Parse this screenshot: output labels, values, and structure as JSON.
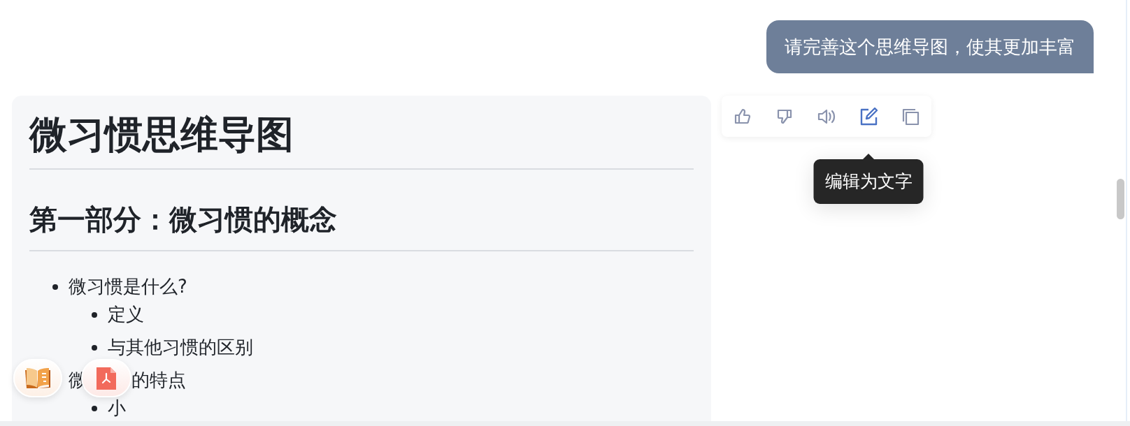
{
  "user_message": "请完善这个思维导图，使其更加丰富",
  "answer": {
    "title": "微习惯思维导图",
    "sections": [
      {
        "heading": "第一部分：微习惯的概念",
        "items": [
          {
            "text_parts": [
              "微习惯是什么?"
            ],
            "bullet": true,
            "children": [
              {
                "text_parts": [
                  "定义"
                ],
                "bullet": true
              },
              {
                "text_parts": [
                  "与其他习惯的区别"
                ],
                "bullet": true
              }
            ]
          },
          {
            "text_parts": [
              "微",
              "的特点"
            ],
            "bullet": false,
            "children": [
              {
                "text_parts": [
                  "小"
                ],
                "bullet": true
              }
            ]
          }
        ]
      }
    ]
  },
  "toolbar": {
    "buttons": [
      {
        "kind": "like",
        "active": false
      },
      {
        "kind": "dislike",
        "active": false
      },
      {
        "kind": "speak",
        "active": false
      },
      {
        "kind": "edit",
        "active": true
      },
      {
        "kind": "copy",
        "active": false
      }
    ],
    "tooltip": "编辑为文字"
  },
  "floating_buttons": [
    {
      "kind": "book"
    },
    {
      "kind": "pdf"
    }
  ]
}
